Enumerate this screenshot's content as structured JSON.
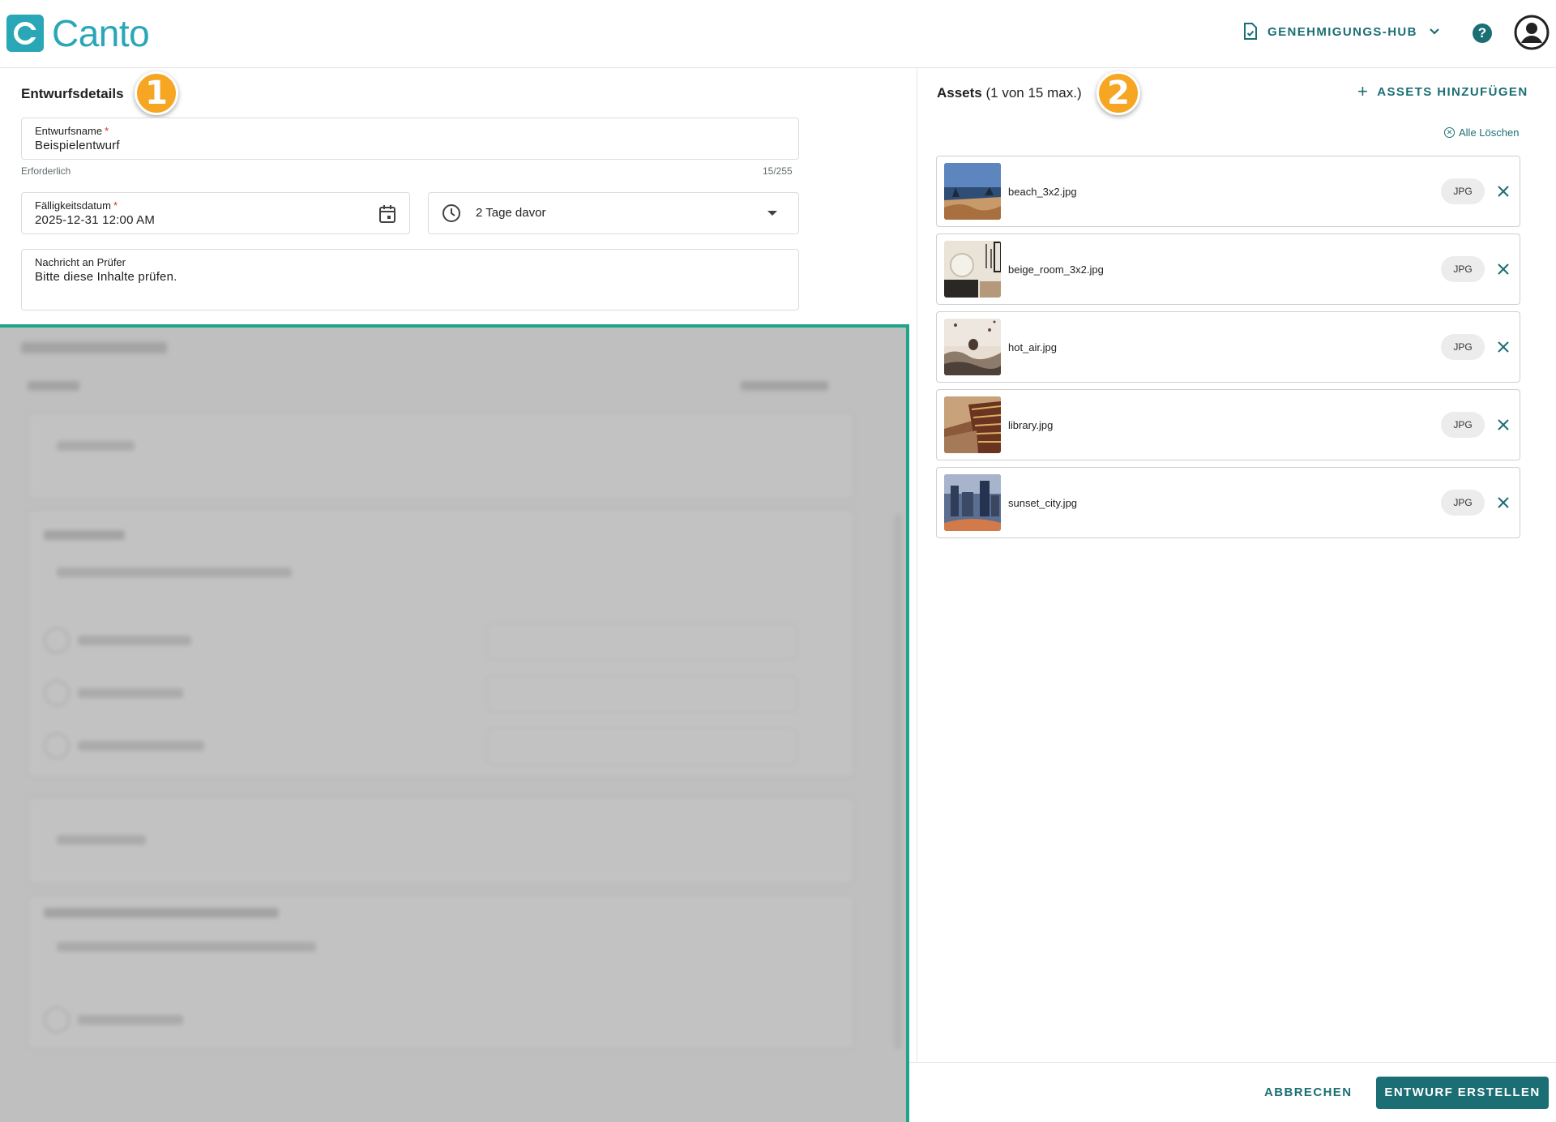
{
  "brand": {
    "name": "Canto",
    "color": "#2aa7b6"
  },
  "header": {
    "hub_label": "GENEHMIGUNGS-HUB",
    "hub_icon": "document-check-icon",
    "help_label": "?"
  },
  "draft": {
    "section_title": "Entwurfsdetails",
    "badge": "1",
    "name_field": {
      "label": "Entwurfsname",
      "required_mark": "*",
      "value": "Beispielentwurf",
      "hint": "Erforderlich",
      "counter": "15/255"
    },
    "due_field": {
      "label": "Fälligkeitsdatum",
      "required_mark": "*",
      "value": "2025-12-31 12:00 AM"
    },
    "reminder_select": {
      "value": "2 Tage davor"
    },
    "message_field": {
      "label": "Nachricht an Prüfer",
      "value": "Bitte diese Inhalte prüfen."
    }
  },
  "assets": {
    "title": "Assets",
    "count_text": "(1 von 15 max.)",
    "badge": "2",
    "add_label": "ASSETS HINZUFÜGEN",
    "clear_label": "Alle Löschen",
    "items": [
      {
        "name": "beach_3x2.jpg",
        "type": "JPG"
      },
      {
        "name": "beige_room_3x2.jpg",
        "type": "JPG"
      },
      {
        "name": "hot_air.jpg",
        "type": "JPG"
      },
      {
        "name": "library.jpg",
        "type": "JPG"
      },
      {
        "name": "sunset_city.jpg",
        "type": "JPG"
      }
    ]
  },
  "footer": {
    "cancel_label": "ABBRECHEN",
    "create_label": "ENTWURF ERSTELLEN"
  },
  "colors": {
    "accent": "#1b6e74",
    "badge": "#f6a623",
    "highlight_border": "#1fa58a"
  }
}
